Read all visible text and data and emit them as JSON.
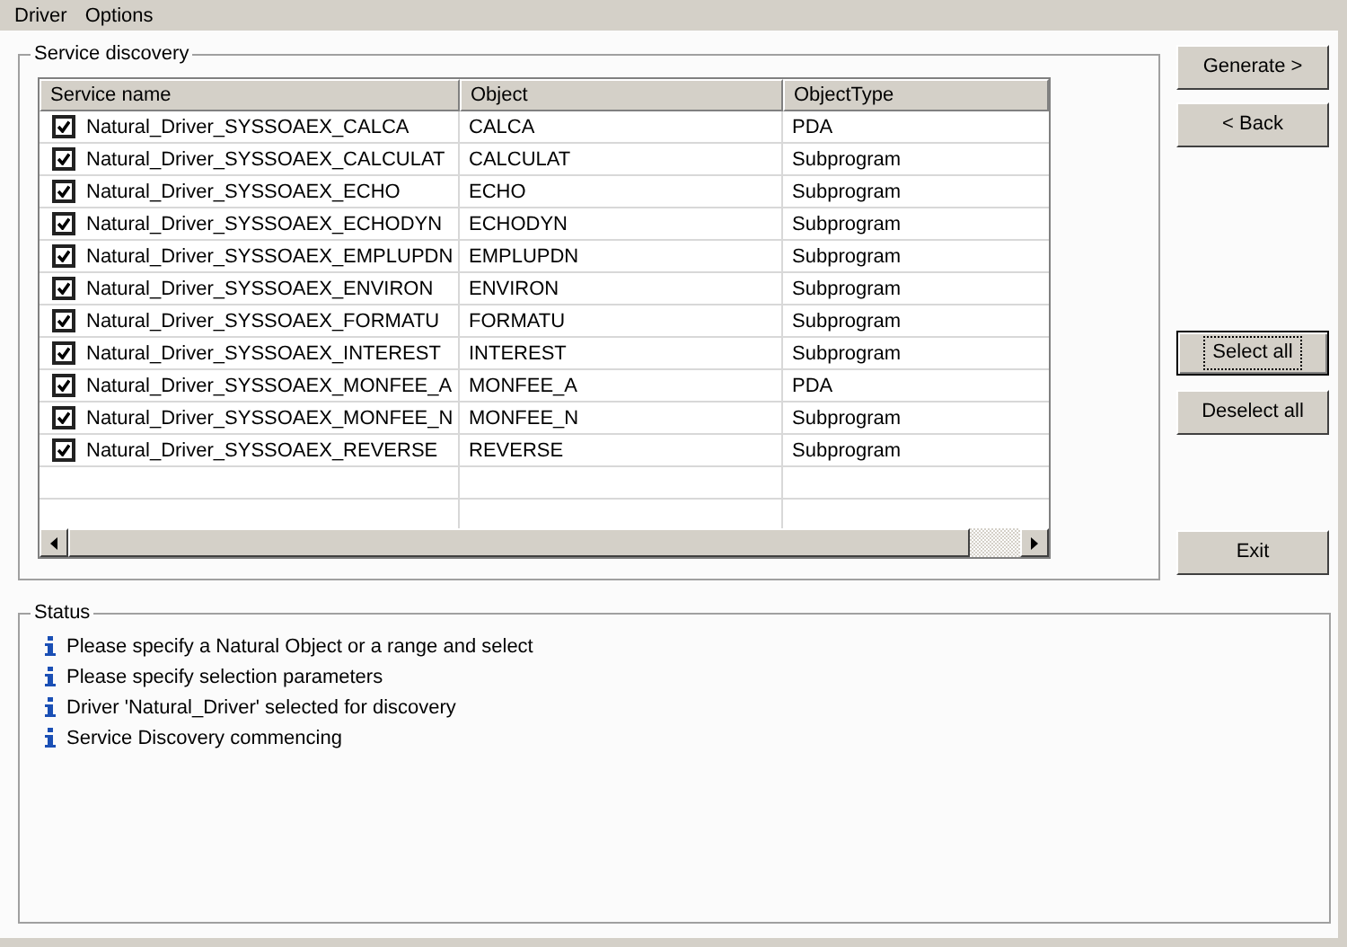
{
  "menu": [
    "Driver",
    "Options"
  ],
  "discovery": {
    "title": "Service discovery",
    "columns": [
      "Service name",
      "Object",
      "ObjectType"
    ],
    "rows": [
      {
        "checked": true,
        "service": "Natural_Driver_SYSSOAEX_CALCA",
        "object": "CALCA",
        "type": "PDA"
      },
      {
        "checked": true,
        "service": "Natural_Driver_SYSSOAEX_CALCULAT",
        "object": "CALCULAT",
        "type": "Subprogram"
      },
      {
        "checked": true,
        "service": "Natural_Driver_SYSSOAEX_ECHO",
        "object": "ECHO",
        "type": "Subprogram"
      },
      {
        "checked": true,
        "service": "Natural_Driver_SYSSOAEX_ECHODYN",
        "object": "ECHODYN",
        "type": "Subprogram"
      },
      {
        "checked": true,
        "service": "Natural_Driver_SYSSOAEX_EMPLUPDN",
        "object": "EMPLUPDN",
        "type": "Subprogram"
      },
      {
        "checked": true,
        "service": "Natural_Driver_SYSSOAEX_ENVIRON",
        "object": "ENVIRON",
        "type": "Subprogram"
      },
      {
        "checked": true,
        "service": "Natural_Driver_SYSSOAEX_FORMATU",
        "object": "FORMATU",
        "type": "Subprogram"
      },
      {
        "checked": true,
        "service": "Natural_Driver_SYSSOAEX_INTEREST",
        "object": "INTEREST",
        "type": "Subprogram"
      },
      {
        "checked": true,
        "service": "Natural_Driver_SYSSOAEX_MONFEE_A",
        "object": "MONFEE_A",
        "type": "PDA"
      },
      {
        "checked": true,
        "service": "Natural_Driver_SYSSOAEX_MONFEE_N",
        "object": "MONFEE_N",
        "type": "Subprogram"
      },
      {
        "checked": true,
        "service": "Natural_Driver_SYSSOAEX_REVERSE",
        "object": "REVERSE",
        "type": "Subprogram"
      }
    ]
  },
  "buttons": [
    {
      "label": "Generate >",
      "focused": false
    },
    {
      "label": "< Back",
      "focused": false
    },
    {
      "label": "Select all",
      "focused": true
    },
    {
      "label": "Deselect all",
      "focused": false
    },
    {
      "label": "Exit",
      "focused": false
    }
  ],
  "status": {
    "title": "Status",
    "messages": [
      "Please specify a Natural Object or a range and select",
      "Please specify selection parameters",
      "Driver 'Natural_Driver' selected for discovery",
      "Service Discovery commencing"
    ]
  }
}
